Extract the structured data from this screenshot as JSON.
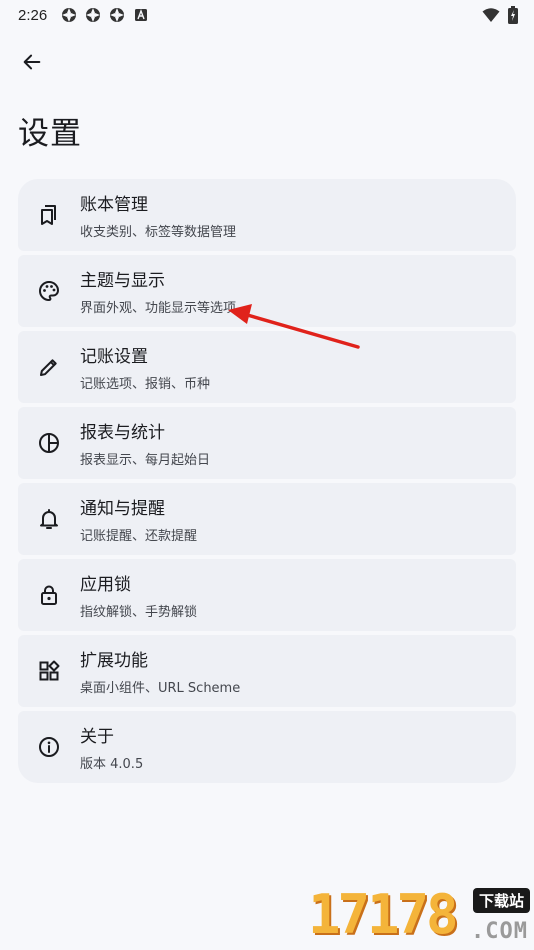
{
  "status_bar": {
    "time": "2:26"
  },
  "header": {
    "title": "设置"
  },
  "settings": [
    {
      "icon": "book-icon",
      "title": "账本管理",
      "subtitle": "收支类别、标签等数据管理"
    },
    {
      "icon": "palette-icon",
      "title": "主题与显示",
      "subtitle": "界面外观、功能显示等选项"
    },
    {
      "icon": "pencil-icon",
      "title": "记账设置",
      "subtitle": "记账选项、报销、币种"
    },
    {
      "icon": "pie-chart-icon",
      "title": "报表与统计",
      "subtitle": "报表显示、每月起始日"
    },
    {
      "icon": "bell-icon",
      "title": "通知与提醒",
      "subtitle": "记账提醒、还款提醒"
    },
    {
      "icon": "lock-icon",
      "title": "应用锁",
      "subtitle": "指纹解锁、手势解锁"
    },
    {
      "icon": "widgets-icon",
      "title": "扩展功能",
      "subtitle": "桌面小组件、URL Scheme"
    },
    {
      "icon": "info-icon",
      "title": "关于",
      "subtitle": "版本 4.0.5"
    }
  ],
  "colors": {
    "background": "#f7f8fb",
    "card": "#eef0f5",
    "annotation": "#e0221b"
  },
  "watermark": {
    "digits": "17178",
    "badge": "下载站",
    "suffix": ".COM"
  }
}
